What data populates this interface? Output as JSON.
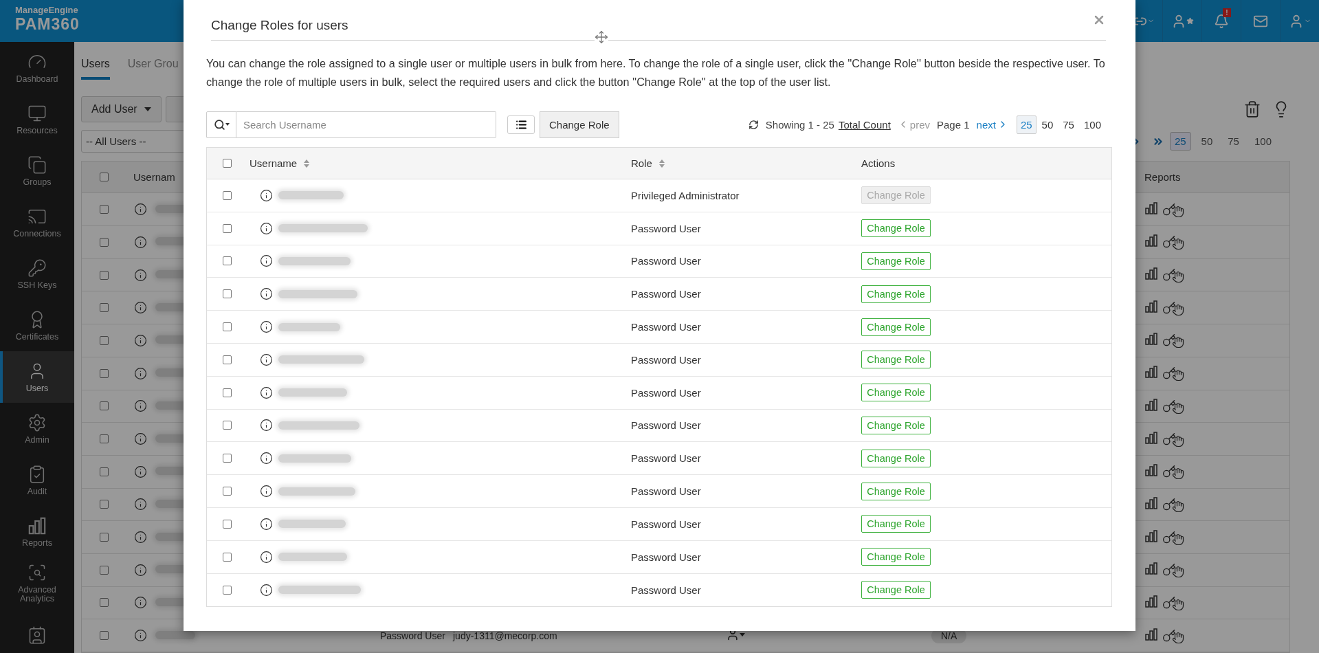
{
  "header": {
    "brand": "ManageEngine",
    "product": "PAM360",
    "alert_badge": "!"
  },
  "sidebar": {
    "items": [
      {
        "label": "Dashboard",
        "kind": "gauge",
        "selected": false
      },
      {
        "label": "Resources",
        "kind": "monitor",
        "selected": false
      },
      {
        "label": "Groups",
        "kind": "monitors",
        "selected": false
      },
      {
        "label": "Connections",
        "kind": "cast",
        "selected": false
      },
      {
        "label": "SSH Keys",
        "kind": "key",
        "selected": false
      },
      {
        "label": "Certificates",
        "kind": "certificate",
        "selected": false
      },
      {
        "label": "Users",
        "kind": "user",
        "selected": true
      },
      {
        "label": "Admin",
        "kind": "gear",
        "selected": false
      },
      {
        "label": "Audit",
        "kind": "clipboard",
        "selected": false
      },
      {
        "label": "Reports",
        "kind": "bars",
        "selected": false
      },
      {
        "label": "Advanced Analytics",
        "kind": "analytics",
        "selected": false
      },
      {
        "kind": "contact",
        "selected": false
      }
    ]
  },
  "page": {
    "tabs": [
      {
        "label": "Users",
        "selected": true
      },
      {
        "label": "User Grou",
        "selected": false
      }
    ],
    "add_button": "Add User",
    "filter": "-- All Users --",
    "page_sizes": [
      {
        "label": "25",
        "selected": true
      },
      {
        "label": "50",
        "selected": false
      },
      {
        "label": "75",
        "selected": false
      },
      {
        "label": "100",
        "selected": false
      }
    ],
    "table": {
      "columns": [
        "Usernam",
        "Reports"
      ],
      "all_checked": false,
      "rows": [
        {
          "checked": false
        },
        {
          "checked": false
        },
        {
          "checked": false
        },
        {
          "checked": false
        },
        {
          "checked": false
        },
        {
          "checked": false
        },
        {
          "checked": false
        },
        {
          "checked": false
        },
        {
          "checked": false
        },
        {
          "checked": false
        },
        {
          "checked": false
        },
        {
          "checked": false
        },
        {
          "checked": false
        },
        {
          "checked": false,
          "role": "Password User",
          "email": "judy-1311@mecorp.com",
          "status": "N/A"
        }
      ]
    }
  },
  "dialog": {
    "title": "Change Roles for users",
    "description": "You can change the role assigned to a single user or multiple users in bulk from here. To change the role of a single user, click the ''Change Role'' button beside the respective user. To change the role of multiple users in bulk, select the required users and click the button ''Change Role'' at the top of the user list.",
    "search": {
      "placeholder": "Search Username"
    },
    "bulk_button": "Change Role",
    "pager": {
      "showing": "Showing 1 - 25",
      "total": "Total Count",
      "prev": {
        "label": "prev",
        "disabled": true
      },
      "page": "Page 1",
      "next": {
        "label": "next",
        "disabled": false
      },
      "sizes": [
        {
          "label": "25",
          "selected": true
        },
        {
          "label": "50",
          "selected": false
        },
        {
          "label": "75",
          "selected": false
        },
        {
          "label": "100",
          "selected": false
        }
      ]
    },
    "table": {
      "columns": [
        "Username",
        "Role",
        "Actions"
      ],
      "all_checked": false,
      "rows": [
        {
          "checked": false,
          "role": "Privileged Administrator",
          "action": "Change Role",
          "disabled": true
        },
        {
          "checked": false,
          "role": "Password User",
          "action": "Change Role",
          "disabled": false
        },
        {
          "checked": false,
          "role": "Password User",
          "action": "Change Role",
          "disabled": false
        },
        {
          "checked": false,
          "role": "Password User",
          "action": "Change Role",
          "disabled": false
        },
        {
          "checked": false,
          "role": "Password User",
          "action": "Change Role",
          "disabled": false
        },
        {
          "checked": false,
          "role": "Password User",
          "action": "Change Role",
          "disabled": false
        },
        {
          "checked": false,
          "role": "Password User",
          "action": "Change Role",
          "disabled": false
        },
        {
          "checked": false,
          "role": "Password User",
          "action": "Change Role",
          "disabled": false
        },
        {
          "checked": false,
          "role": "Password User",
          "action": "Change Role",
          "disabled": false
        },
        {
          "checked": false,
          "role": "Password User",
          "action": "Change Role",
          "disabled": false
        },
        {
          "checked": false,
          "role": "Password User",
          "action": "Change Role",
          "disabled": false
        },
        {
          "checked": false,
          "role": "Password User",
          "action": "Change Role",
          "disabled": false
        },
        {
          "checked": false,
          "role": "Password User",
          "action": "Change Role",
          "disabled": false
        }
      ]
    }
  }
}
